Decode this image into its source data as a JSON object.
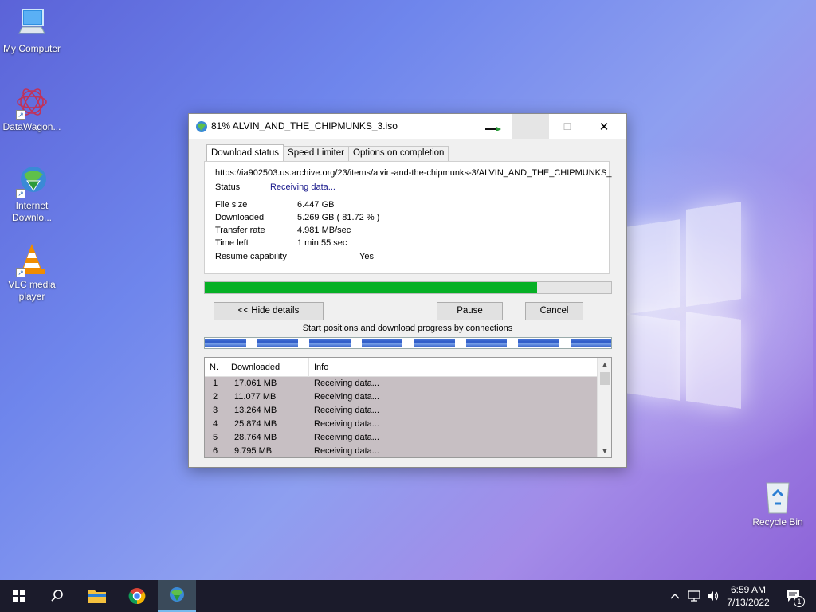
{
  "desktop": {
    "icons": [
      {
        "label": "My Computer"
      },
      {
        "label": "DataWagon..."
      },
      {
        "label": "Internet\nDownlo..."
      },
      {
        "label": "VLC media\nplayer"
      },
      {
        "label": "Recycle Bin"
      }
    ]
  },
  "window": {
    "title": "81% ALVIN_AND_THE_CHIPMUNKS_3.iso",
    "minimize_glyph": "—",
    "maximize_glyph": "☐",
    "close_glyph": "✕",
    "tabs": [
      "Download status",
      "Speed Limiter",
      "Options on completion"
    ],
    "active_tab": "Download status",
    "url": "https://ia902503.us.archive.org/23/items/alvin-and-the-chipmunks-3/ALVIN_AND_THE_CHIPMUNKS_",
    "status_label": "Status",
    "status_value": "Receiving data...",
    "details": {
      "file_size_label": "File size",
      "file_size_value": "6.447  GB",
      "downloaded_label": "Downloaded",
      "downloaded_value": "5.269  GB  ( 81.72 % )",
      "transfer_rate_label": "Transfer rate",
      "transfer_rate_value": "4.981  MB/sec",
      "time_left_label": "Time left",
      "time_left_value": "1 min 55 sec",
      "resume_label": "Resume capability",
      "resume_value": "Yes"
    },
    "progress_fraction": 0.8172,
    "buttons": {
      "hide_details": "<< Hide details",
      "pause": "Pause",
      "cancel": "Cancel"
    },
    "connections_caption": "Start positions and download progress by connections",
    "connection_segments": 8,
    "list": {
      "headers": [
        "N.",
        "Downloaded",
        "Info"
      ],
      "rows": [
        {
          "n": "1",
          "downloaded": "17.061  MB",
          "info": "Receiving data..."
        },
        {
          "n": "2",
          "downloaded": "11.077  MB",
          "info": "Receiving data..."
        },
        {
          "n": "3",
          "downloaded": "13.264  MB",
          "info": "Receiving data..."
        },
        {
          "n": "4",
          "downloaded": "25.874  MB",
          "info": "Receiving data..."
        },
        {
          "n": "5",
          "downloaded": "28.764  MB",
          "info": "Receiving data..."
        },
        {
          "n": "6",
          "downloaded": "9.795  MB",
          "info": "Receiving data..."
        }
      ]
    }
  },
  "taskbar": {
    "time": "6:59 AM",
    "date": "7/13/2022",
    "notification_count": "1",
    "accent": "#76b9ed"
  },
  "colors": {
    "progress": "#06b025",
    "status_text": "#1a1a8c"
  }
}
